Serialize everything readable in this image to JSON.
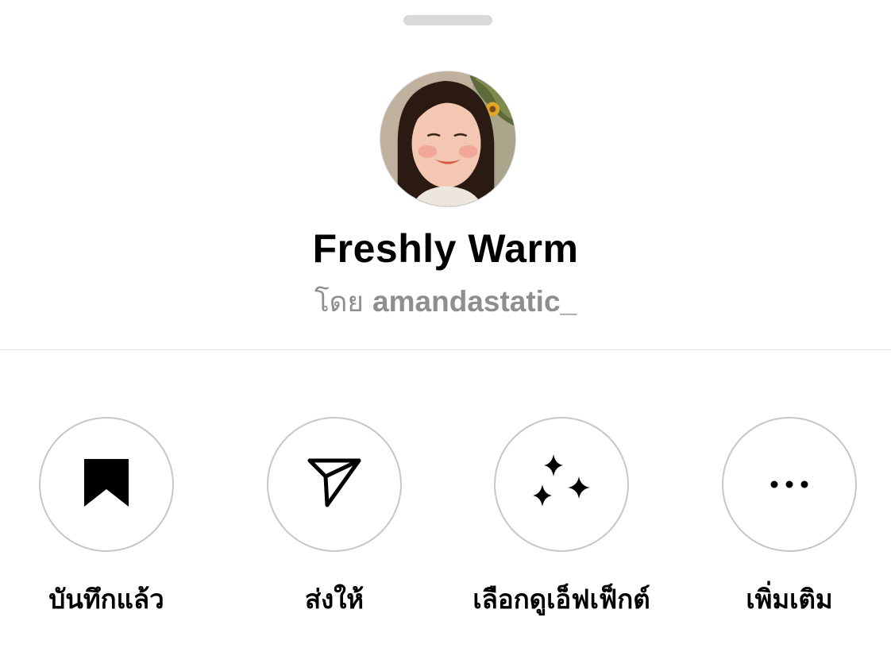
{
  "sheet": {
    "effect_name": "Freshly Warm",
    "byline_prefix": "โดย",
    "creator_handle": "amandastatic_"
  },
  "actions": [
    {
      "label": "บันทึกแล้ว",
      "icon": "bookmark-filled-icon"
    },
    {
      "label": "ส่งให้",
      "icon": "paper-plane-icon"
    },
    {
      "label": "เลือกดูเอ็ฟเฟ็กต์",
      "icon": "sparkles-icon"
    },
    {
      "label": "เพิ่มเติม",
      "icon": "more-dots-icon"
    }
  ],
  "colors": {
    "background": "#ffffff",
    "secondary_text": "#8e8e8e",
    "circle_border": "#c7c7c7",
    "divider": "#dbdbdb",
    "grabber": "#d9d9d9"
  }
}
